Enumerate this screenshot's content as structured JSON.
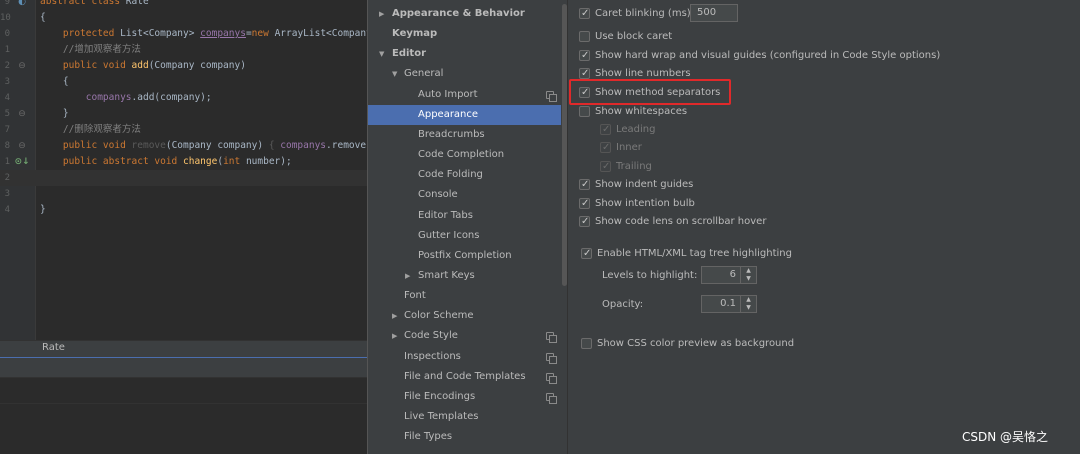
{
  "editor": {
    "lines": [
      {
        "num": "9",
        "gutter": "impl",
        "html_parts": [
          [
            "k",
            "abstract class "
          ],
          [
            "",
            "Rate"
          ]
        ]
      },
      {
        "num": "10",
        "gutter": "",
        "html_parts": [
          [
            "",
            "{"
          ]
        ]
      },
      {
        "num": "0",
        "gutter": "",
        "html_parts": [
          [
            "",
            "    "
          ],
          [
            "k",
            "protected "
          ],
          [
            "",
            "List<Company> "
          ],
          [
            "u",
            "companys"
          ],
          [
            "",
            "="
          ],
          [
            "k",
            "new "
          ],
          [
            "",
            "ArrayList<Company"
          ]
        ]
      },
      {
        "num": "1",
        "gutter": "",
        "html_parts": [
          [
            "",
            "    "
          ],
          [
            "c",
            "//增加观察者方法"
          ]
        ]
      },
      {
        "num": "2",
        "gutter": "fold",
        "html_parts": [
          [
            "",
            "    "
          ],
          [
            "k",
            "public void "
          ],
          [
            "f",
            "add"
          ],
          [
            "",
            "(Company company)"
          ]
        ]
      },
      {
        "num": "3",
        "gutter": "",
        "html_parts": [
          [
            "",
            "    {"
          ]
        ]
      },
      {
        "num": "4",
        "gutter": "",
        "html_parts": [
          [
            "",
            "        "
          ],
          [
            "v",
            "companys"
          ],
          [
            "",
            ".add(company);"
          ]
        ]
      },
      {
        "num": "5",
        "gutter": "fold",
        "html_parts": [
          [
            "",
            "    }"
          ]
        ]
      },
      {
        "num": "7",
        "gutter": "",
        "html_parts": [
          [
            "",
            "    "
          ],
          [
            "c",
            "//删除观察者方法"
          ]
        ]
      },
      {
        "num": "8",
        "gutter": "fold",
        "html_parts": [
          [
            "",
            "    "
          ],
          [
            "k",
            "public void "
          ],
          [
            "g",
            "remove"
          ],
          [
            "",
            "(Company company) "
          ],
          [
            "g",
            "{ "
          ],
          [
            "v",
            "companys"
          ],
          [
            "",
            ".remove("
          ]
        ]
      },
      {
        "num": "1",
        "gutter": "implarrow",
        "html_parts": [
          [
            "",
            "    "
          ],
          [
            "k",
            "public abstract void "
          ],
          [
            "f",
            "change"
          ],
          [
            "",
            "("
          ],
          [
            "k",
            "int "
          ],
          [
            "",
            "number);"
          ]
        ]
      },
      {
        "num": "2",
        "gutter": "",
        "html_parts": [
          [
            "",
            ""
          ]
        ]
      },
      {
        "num": "3",
        "gutter": "",
        "html_parts": [
          [
            "",
            ""
          ]
        ]
      },
      {
        "num": "4",
        "gutter": "",
        "html_parts": [
          [
            "",
            "}"
          ]
        ]
      }
    ],
    "breadcrumb": "Rate"
  },
  "tree": {
    "items": [
      {
        "label": "Appearance & Behavior",
        "indent": 0,
        "arrow": "right",
        "bold": true
      },
      {
        "label": "Keymap",
        "indent": 0,
        "arrow": "",
        "bold": true
      },
      {
        "label": "Editor",
        "indent": 0,
        "arrow": "down",
        "bold": true
      },
      {
        "label": "General",
        "indent": 1,
        "arrow": "down",
        "bold": false
      },
      {
        "label": "Auto Import",
        "indent": 2,
        "arrow": "",
        "bold": false,
        "copy": true
      },
      {
        "label": "Appearance",
        "indent": 2,
        "arrow": "",
        "bold": false,
        "selected": true
      },
      {
        "label": "Breadcrumbs",
        "indent": 2,
        "arrow": "",
        "bold": false
      },
      {
        "label": "Code Completion",
        "indent": 2,
        "arrow": "",
        "bold": false
      },
      {
        "label": "Code Folding",
        "indent": 2,
        "arrow": "",
        "bold": false
      },
      {
        "label": "Console",
        "indent": 2,
        "arrow": "",
        "bold": false
      },
      {
        "label": "Editor Tabs",
        "indent": 2,
        "arrow": "",
        "bold": false
      },
      {
        "label": "Gutter Icons",
        "indent": 2,
        "arrow": "",
        "bold": false
      },
      {
        "label": "Postfix Completion",
        "indent": 2,
        "arrow": "",
        "bold": false
      },
      {
        "label": "Smart Keys",
        "indent": 2,
        "arrow": "right",
        "bold": false
      },
      {
        "label": "Font",
        "indent": 1,
        "arrow": "",
        "bold": false
      },
      {
        "label": "Color Scheme",
        "indent": 1,
        "arrow": "right",
        "bold": false
      },
      {
        "label": "Code Style",
        "indent": 1,
        "arrow": "right",
        "bold": false,
        "copy": true
      },
      {
        "label": "Inspections",
        "indent": 1,
        "arrow": "",
        "bold": false,
        "copy": true
      },
      {
        "label": "File and Code Templates",
        "indent": 1,
        "arrow": "",
        "bold": false,
        "copy": true
      },
      {
        "label": "File Encodings",
        "indent": 1,
        "arrow": "",
        "bold": false,
        "copy": true
      },
      {
        "label": "Live Templates",
        "indent": 1,
        "arrow": "",
        "bold": false
      },
      {
        "label": "File Types",
        "indent": 1,
        "arrow": "",
        "bold": false
      }
    ]
  },
  "options": {
    "caret_blinking": {
      "label": "Caret blinking (ms):",
      "checked": true,
      "value": "500"
    },
    "use_block_caret": {
      "label": "Use block caret",
      "checked": false
    },
    "show_hard_wrap": {
      "label": "Show hard wrap and visual guides (configured in Code Style options)",
      "checked": true
    },
    "show_line_numbers": {
      "label": "Show line numbers",
      "checked": true
    },
    "show_method_separators": {
      "label": "Show method separators",
      "checked": true
    },
    "show_whitespaces": {
      "label": "Show whitespaces",
      "checked": false
    },
    "leading": {
      "label": "Leading",
      "checked": true
    },
    "inner": {
      "label": "Inner",
      "checked": true
    },
    "trailing": {
      "label": "Trailing",
      "checked": true
    },
    "show_indent_guides": {
      "label": "Show indent guides",
      "checked": true
    },
    "show_intention_bulb": {
      "label": "Show intention bulb",
      "checked": true
    },
    "show_code_lens": {
      "label": "Show code lens on scrollbar hover",
      "checked": true
    },
    "enable_tag_tree": {
      "label": "Enable HTML/XML tag tree highlighting",
      "checked": true
    },
    "levels_to_highlight": {
      "label": "Levels to highlight:",
      "value": "6"
    },
    "opacity": {
      "label": "Opacity:",
      "value": "0.1"
    },
    "show_css_preview": {
      "label": "Show CSS color preview as background",
      "checked": false
    }
  },
  "watermark": "CSDN @吴恪之"
}
